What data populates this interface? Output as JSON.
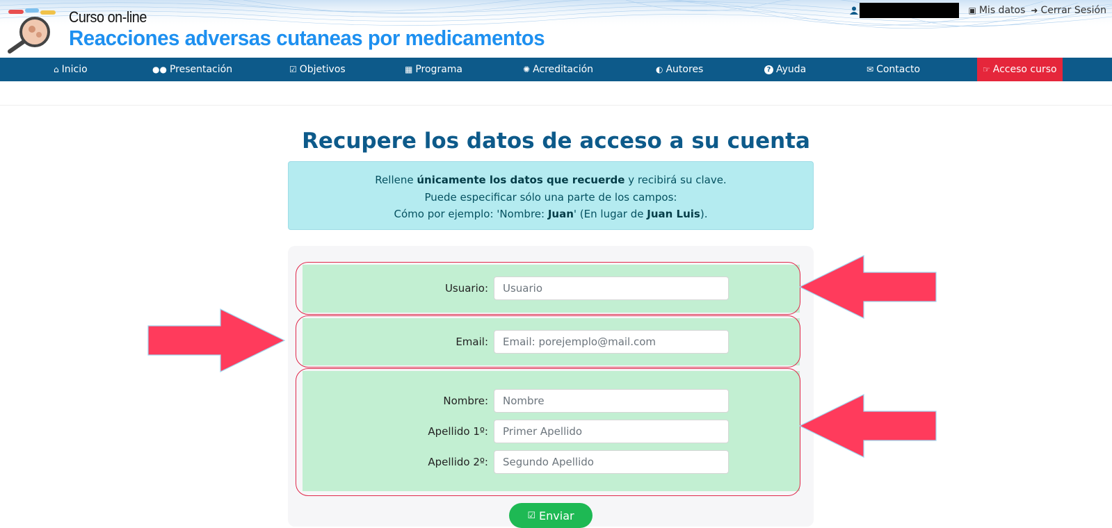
{
  "header": {
    "brand_small": "Curso on-line",
    "brand_big": "Reacciones adversas cutaneas por medicamentos",
    "user_links": [
      {
        "label": "Mis datos",
        "icon": "id-card-icon"
      },
      {
        "label": "Cerrar Sesión",
        "icon": "sign-out-icon"
      }
    ]
  },
  "nav": {
    "items": [
      {
        "label": "Inicio",
        "icon": "home-icon",
        "glyph": "⌂"
      },
      {
        "label": "Presentación",
        "icon": "users-icon",
        "glyph": "👥"
      },
      {
        "label": "Objetivos",
        "icon": "check-square-icon",
        "glyph": "☑"
      },
      {
        "label": "Programa",
        "icon": "calendar-check-icon",
        "glyph": "📅"
      },
      {
        "label": "Acreditación",
        "icon": "certificate-icon",
        "glyph": "✺"
      },
      {
        "label": "Autores",
        "icon": "shield-icon",
        "glyph": "◐"
      },
      {
        "label": "Ayuda",
        "icon": "question-circle-icon",
        "glyph": "?"
      },
      {
        "label": "Contacto",
        "icon": "envelope-icon",
        "glyph": "✉"
      },
      {
        "label": "Acceso curso",
        "icon": "hand-pointer-icon",
        "glyph": "☞"
      }
    ],
    "active_color": "#e5263b",
    "bar_color": "#0d5a8a"
  },
  "main": {
    "title": "Recupere los datos de acceso a su cuenta",
    "info": {
      "line1_pre": "Rellene ",
      "line1_bold": "únicamente los datos que recuerde",
      "line1_post": " y recibirá su clave.",
      "line2": "Puede especificar sólo una parte de los campos:",
      "line3_pre": "Cómo por ejemplo: 'Nombre: ",
      "line3_bold1": "Juan",
      "line3_mid": "' (En lugar de ",
      "line3_bold2": "Juan Luis",
      "line3_post": ")."
    },
    "form": {
      "usuario": {
        "label": "Usuario:",
        "placeholder": "Usuario",
        "value": ""
      },
      "email": {
        "label": "Email:",
        "placeholder": "Email: porejemplo@mail.com",
        "value": ""
      },
      "nombre": {
        "label": "Nombre:",
        "placeholder": "Nombre",
        "value": ""
      },
      "apellido1": {
        "label": "Apellido 1º:",
        "placeholder": "Primer Apellido",
        "value": ""
      },
      "apellido2": {
        "label": "Apellido 2º:",
        "placeholder": "Segundo Apellido",
        "value": ""
      },
      "submit_label": "Enviar",
      "submit_color": "#1eb954"
    },
    "annotation_color": "#ff3b5c"
  }
}
